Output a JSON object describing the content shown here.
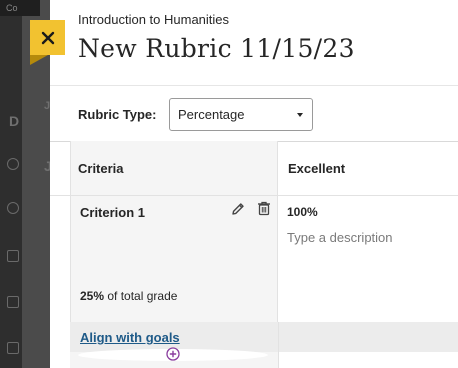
{
  "background": {
    "topbar_text": "Co",
    "letters": [
      "Jo",
      "D",
      "J"
    ]
  },
  "panel": {
    "course_name": "Introduction to Humanities",
    "title": "New Rubric 11/15/23",
    "close_icon": "close-icon"
  },
  "rubric_type": {
    "label": "Rubric Type:",
    "selected": "Percentage"
  },
  "table": {
    "headers": {
      "criteria": "Criteria",
      "level": "Excellent"
    },
    "criterion": {
      "name": "Criterion 1",
      "level_value": "100%",
      "description_placeholder": "Type a description",
      "grade_percent": "25%",
      "grade_suffix": " of total grade",
      "align_link": "Align with goals",
      "icons": [
        "pencil-icon",
        "trash-icon",
        "add-circle-icon"
      ]
    }
  },
  "colors": {
    "accent_yellow": "#f2c230",
    "link_blue": "#1e5a88",
    "add_purple": "#8a3d9e"
  }
}
